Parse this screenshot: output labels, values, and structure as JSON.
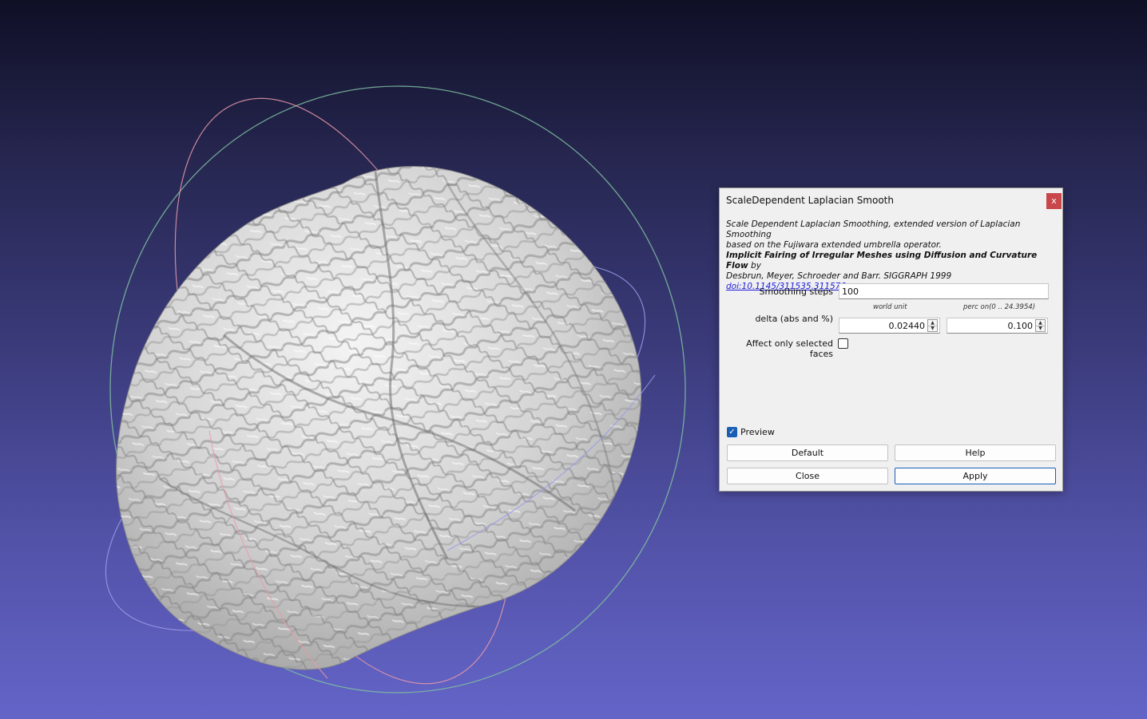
{
  "dialog": {
    "title": "ScaleDependent Laplacian Smooth",
    "close_label": "x",
    "description": {
      "line1": "Scale Dependent Laplacian Smoothing, extended version of Laplacian Smoothing",
      "line2": "based on the Fujiwara extended umbrella operator.",
      "paper_title": "Implicit Fairing of Irregular Meshes using Diffusion and Curvature Flow",
      "by": " by",
      "authors": "Desbrun, Meyer, Schroeder and Barr. SIGGRAPH 1999",
      "doi": "doi:10.1145/311535.311576"
    },
    "smoothing_steps": {
      "label": "Smoothing steps",
      "value": "100"
    },
    "delta": {
      "label": "delta (abs and %)",
      "world_unit_label": "world unit",
      "perc_label": "perc on(0 .. 24.3954)",
      "abs_value": "0.02440",
      "perc_value": "0.100"
    },
    "affect_selected": {
      "label": "Affect only selected faces",
      "checked": false
    },
    "preview": {
      "label": "Preview",
      "checked": true
    },
    "buttons": {
      "default": "Default",
      "help": "Help",
      "close": "Close",
      "apply": "Apply"
    }
  },
  "viewport": {
    "background_top": "#0f0f26",
    "background_bottom": "#6464c8",
    "mesh_color": "#d8d8d8",
    "trackball_colors": [
      "#7fbf9f",
      "#e89aa8",
      "#9a9ae8"
    ]
  }
}
